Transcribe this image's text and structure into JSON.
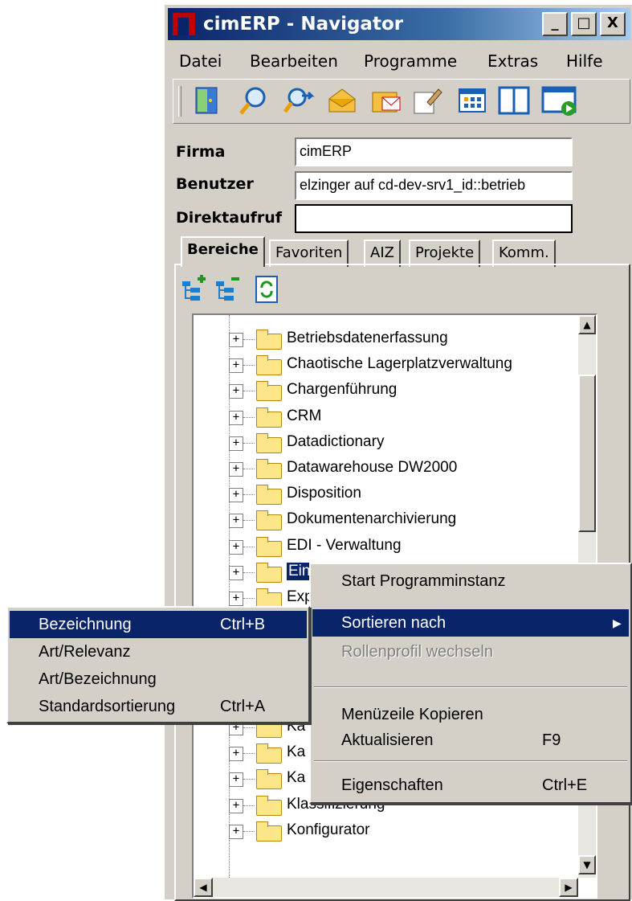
{
  "window": {
    "title": "cimERP - Navigator",
    "caption_min": "_",
    "caption_max": "□",
    "caption_close": "X"
  },
  "menubar": [
    "Datei",
    "Bearbeiten",
    "Programme",
    "Extras",
    "Hilfe"
  ],
  "toolbar": [
    "exit-door-icon",
    "search-icon",
    "find-next-icon",
    "envelope-open-icon",
    "folder-mail-icon",
    "edit-document-icon",
    "grid-table-icon",
    "dual-panel-icon",
    "window-run-icon"
  ],
  "fields": {
    "firma_label": "Firma",
    "firma_value": "cimERP",
    "benutzer_label": "Benutzer",
    "benutzer_value": "elzinger auf cd-dev-srv1_id::betrieb",
    "direktaufruf_label": "Direktaufruf",
    "direktaufruf_value": ""
  },
  "tabs": [
    "Bereiche",
    "Favoriten",
    "AIZ",
    "Projekte",
    "Komm."
  ],
  "tree_tools": [
    "tree-expand-icon",
    "tree-collapse-icon",
    "refresh-icon"
  ],
  "tree": [
    "Betriebsdatenerfassung",
    "Chaotische Lagerplatzverwaltung",
    "Chargenführung",
    "CRM",
    "Datadictionary",
    "Datawarehouse DW2000",
    "Disposition",
    "Dokumentenarchivierung",
    "EDI - Verwaltung",
    "Ein",
    "Exp",
    "",
    "",
    "",
    "",
    "Ka",
    "Ka",
    "Ka",
    "Klassifizierung",
    "Konfigurator"
  ],
  "context_menu": [
    {
      "label": "Start Programminstanz",
      "shortcut": ""
    },
    {
      "label": "Sortieren nach",
      "shortcut": "",
      "submenu": true,
      "selected": true
    },
    {
      "label": "Rollenprofil wechseln",
      "shortcut": "",
      "disabled": true
    },
    {
      "label": "Menüzeile Kopieren",
      "shortcut": ""
    },
    {
      "label": "Aktualisieren",
      "shortcut": "F9"
    },
    {
      "label": "Eigenschaften",
      "shortcut": "Ctrl+E"
    }
  ],
  "submenu": [
    {
      "label": "Bezeichnung",
      "shortcut": "Ctrl+B",
      "selected": true
    },
    {
      "label": "Art/Relevanz",
      "shortcut": ""
    },
    {
      "label": "Art/Bezeichnung",
      "shortcut": ""
    },
    {
      "label": "Standardsortierung",
      "shortcut": "Ctrl+A"
    }
  ],
  "submenu_arrow": "▶"
}
